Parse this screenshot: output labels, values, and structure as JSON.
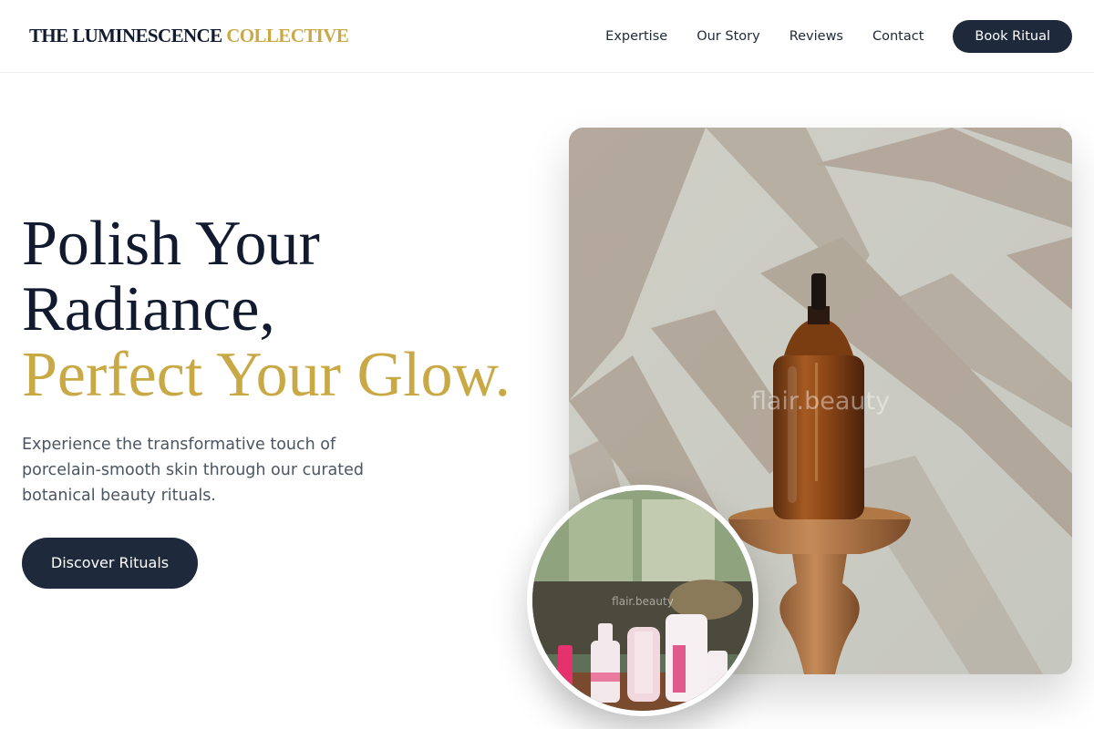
{
  "header": {
    "logo_main": "THE LUMINESCENCE",
    "logo_accent": "COLLECTIVE",
    "nav": [
      "Expertise",
      "Our Story",
      "Reviews",
      "Contact"
    ],
    "book_label": "Book Ritual"
  },
  "hero": {
    "title_line1": "Polish Your",
    "title_line2": "Radiance,",
    "title_line3": "Perfect Your Glow.",
    "subtitle": "Experience the transformative touch of porcelain-smooth skin through our curated botanical beauty rituals.",
    "cta_label": "Discover Rituals"
  },
  "images": {
    "main_watermark": "flair.beauty",
    "circle_watermark": "flair.beauty"
  },
  "colors": {
    "navy": "#1e293b",
    "gold": "#c9a946",
    "text_gray": "#4b5563"
  }
}
